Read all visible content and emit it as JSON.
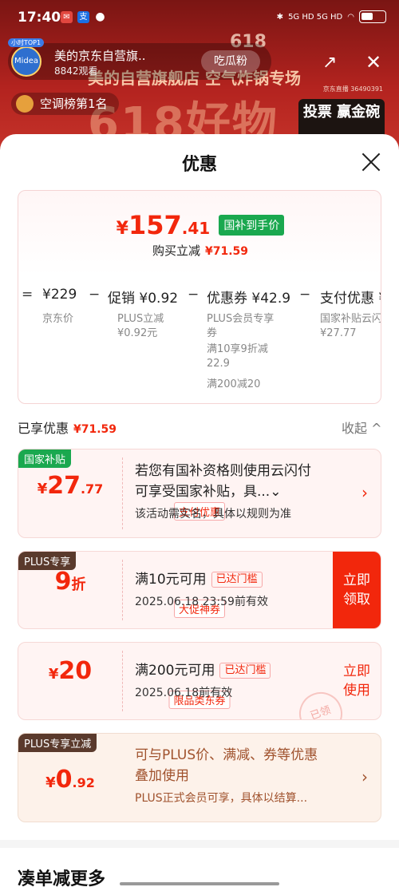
{
  "status_bar": {
    "time": "17:40",
    "network": "5G HD 5G HD",
    "battery": ""
  },
  "live": {
    "shop_badge": "小时TOP1",
    "shop_name": "美的京东自营旗..",
    "viewers": "8842观看",
    "follow_label": "吃瓜粉",
    "promo_banner": "美的自营旗舰店  空气炸锅专场",
    "promo_big": "618好物",
    "promo_618": "618",
    "live_id": "京东直播 36490391",
    "rank_label": "空调榜第1名",
    "vote_label": "投票 赢金碗"
  },
  "sheet": {
    "title": "优惠",
    "final_price": {
      "yen": "¥",
      "int": "157",
      "dec": ".41"
    },
    "final_tag": "国补到手价",
    "instant_label": "购买立减",
    "instant_value": "¥71.59",
    "formula": {
      "eq": "=",
      "jd_price": "¥229",
      "jd_price_label": "京东价",
      "minus": "−",
      "promo": "促销 ¥0.92",
      "promo_sub1": "PLUS立减",
      "promo_sub2": "¥0.92元",
      "coupon": "优惠券 ¥42.9",
      "coupon_sub1": "PLUS会员专享",
      "coupon_sub2": "券",
      "coupon_sub3": "满10享9折减",
      "coupon_sub4": "22.9",
      "coupon_sub5": "满200减20",
      "pay": "支付优惠 ¥",
      "pay_sub1": "国家补贴云闪",
      "pay_sub2": "¥27.77"
    },
    "enjoyed_label": "已享优惠",
    "enjoyed_value": "¥71.59",
    "collapse_label": "收起 ^",
    "cards": [
      {
        "corner": "国家补贴",
        "yen": "¥",
        "int": "27",
        "dec": ".77",
        "chip": "支付优惠",
        "line1": "若您有国补资格则使用云闪付",
        "line2": "可享受国家补贴，具...⌄",
        "line3": "该活动需实名，具体以规则为准",
        "arrow": "›"
      },
      {
        "corner": "PLUS专享",
        "big": "9",
        "unit": "折",
        "chip": "大促神券",
        "line1": "满10元可用",
        "threshold": "已达门槛",
        "line2": "2025.06.18 23:59前有效",
        "action": "立即\n领取"
      },
      {
        "yen": "¥",
        "int": "20",
        "chip": "限品类东券",
        "line1": "满200元可用",
        "threshold": "已达门槛",
        "line2": "2025.06.18前有效",
        "action": "立即\n使用",
        "stamp": "已领"
      },
      {
        "corner": "PLUS专享立减",
        "yen": "¥",
        "int": "0",
        "dec": ".92",
        "line1": "可与PLUS价、满减、券等优惠",
        "line2": "叠加使用",
        "line3": "PLUS正式会员可享，具体以结算...",
        "arrow": "›"
      }
    ],
    "more_title": "凑单减更多"
  },
  "colors": {
    "accent": "#f2270c",
    "green": "#1aa84f",
    "plus_dark": "#5a3a2c"
  }
}
